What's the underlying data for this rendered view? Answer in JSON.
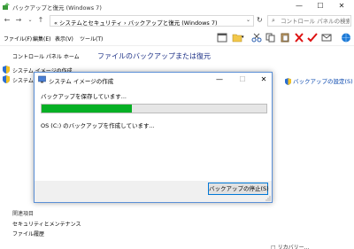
{
  "window": {
    "title": "バックアップと復元 (Windows 7)",
    "minimize": "—",
    "maximize": "☐",
    "close": "✕"
  },
  "address": {
    "breadcrumb": "« システムとセキュリティ › バックアップと復元 (Windows 7)",
    "search_placeholder": "コントロール パネルの検索"
  },
  "menu": {
    "items": [
      "ファイル(F)",
      "編集(E)",
      "表示(V)",
      "ツール(T)"
    ]
  },
  "left_pane": {
    "home": "コントロール パネル ホーム",
    "tasks": [
      "システム イメージの作成",
      "システム"
    ],
    "see_also_title": "関連項目",
    "see_also": [
      "セキュリティとメンテナンス",
      "ファイル履歴"
    ]
  },
  "main": {
    "heading": "ファイルのバックアップまたは復元",
    "settings_link": "バックアップの設定(S)",
    "bottom_fragment": "□ リカバリー..."
  },
  "dialog": {
    "title": "システム イメージの作成",
    "status": "バックアップを保存しています...",
    "progress": 0.4,
    "detail": "OS (C:) のバックアップを作成しています...",
    "stop_button": "バックアップの停止(S)"
  },
  "colors": {
    "progress_fill": "#06b025",
    "accent_blue": "#0078d7",
    "heading_blue": "#1e3287"
  }
}
